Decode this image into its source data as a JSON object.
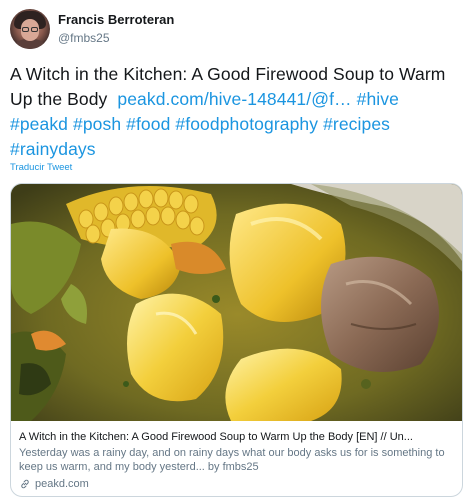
{
  "author": {
    "display_name": "Francis Berroteran",
    "handle": "@fmbs25"
  },
  "tweet": {
    "text_plain": "A Witch in the Kitchen: A Good Firewood Soup to Warm Up the Body",
    "link": "peakd.com/hive-148441/@f…",
    "hashtags": [
      "#hive",
      "#peakd",
      "#posh",
      "#food",
      "#foodphotography",
      "#recipes",
      "#rainydays"
    ],
    "translate_label": "Traducir Tweet"
  },
  "card": {
    "title": "A Witch in the Kitchen: A Good Firewood Soup to Warm Up the Body [EN] // Un...",
    "description": "Yesterday was a rainy day, and on rainy days what our body asks us for is something to keep us warm, and my body yesterd... by fmbs25",
    "domain": "peakd.com",
    "icon": "link-icon"
  },
  "colors": {
    "link": "#1b95e0",
    "secondary_text": "#657786",
    "border": "#ccd6dd"
  }
}
